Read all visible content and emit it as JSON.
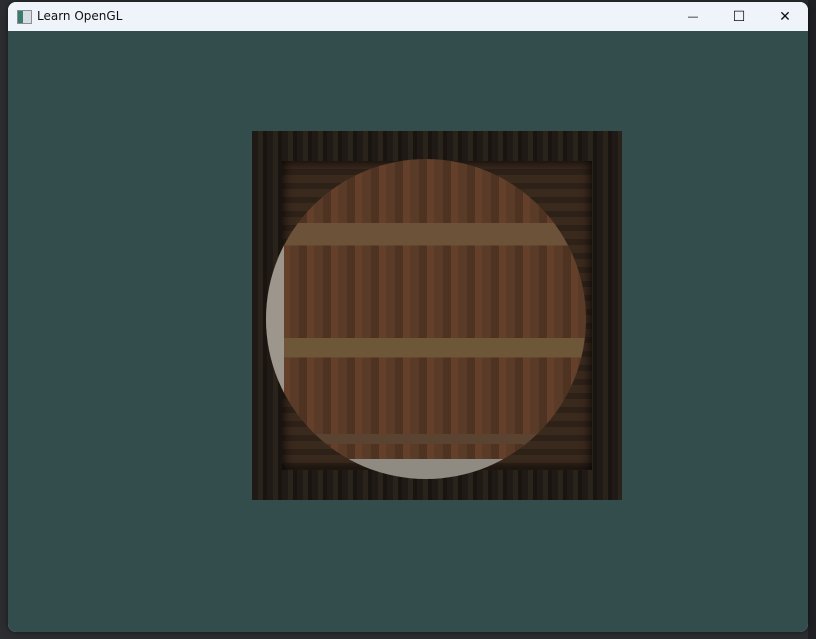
{
  "window": {
    "title": "Learn OpenGL",
    "app_icon": "opengl-window-icon",
    "controls": {
      "minimize": "—",
      "maximize": "☐",
      "close": "✕"
    }
  },
  "colors": {
    "clear_color": "#334d4d",
    "titlebar": "#eff4fb"
  },
  "scene": {
    "content": "textured-crate-with-circular-blend"
  }
}
